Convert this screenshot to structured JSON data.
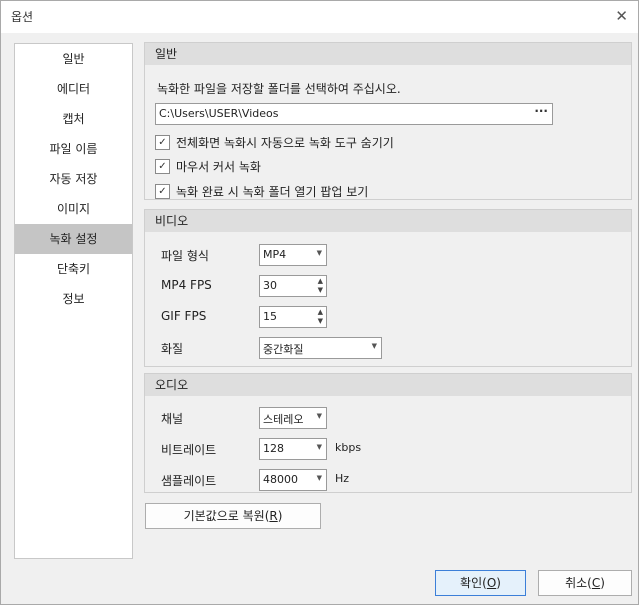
{
  "window": {
    "title": "옵션",
    "close_glyph": "✕"
  },
  "sidebar": {
    "items": [
      {
        "label": "일반"
      },
      {
        "label": "에디터"
      },
      {
        "label": "캡처"
      },
      {
        "label": "파일 이름"
      },
      {
        "label": "자동 저장"
      },
      {
        "label": "이미지"
      },
      {
        "label": "녹화 설정",
        "selected": true
      },
      {
        "label": "단축키"
      },
      {
        "label": "정보"
      }
    ]
  },
  "general": {
    "header": "일반",
    "description": "녹화한 파일을 저장할 폴더를 선택하여 주십시오.",
    "folder_path": "C:\\Users\\USER\\Videos",
    "browse_label": "···",
    "checkboxes": [
      {
        "label": "전체화면 녹화시 자동으로 녹화 도구 숨기기",
        "checked": true
      },
      {
        "label": "마우서 커서 녹화",
        "checked": true
      },
      {
        "label": "녹화 완료 시 녹화 폴더 열기 팝업 보기",
        "checked": true
      }
    ]
  },
  "video": {
    "header": "비디오",
    "format_label": "파일 형식",
    "format_value": "MP4",
    "mp4fps_label": "MP4 FPS",
    "mp4fps_value": "30",
    "giffps_label": "GIF FPS",
    "giffps_value": "15",
    "quality_label": "화질",
    "quality_value": "중간화질"
  },
  "audio": {
    "header": "오디오",
    "channel_label": "채널",
    "channel_value": "스테레오",
    "bitrate_label": "비트레이트",
    "bitrate_value": "128",
    "bitrate_unit": "kbps",
    "samplerate_label": "샘플레이트",
    "samplerate_value": "48000",
    "samplerate_unit": "Hz"
  },
  "buttons": {
    "reset_text": "기본값으로 복원(",
    "reset_key": "R",
    "reset_close": ")",
    "ok_text": "확인(",
    "ok_key": "O",
    "ok_close": ")",
    "cancel_text": "취소(",
    "cancel_key": "C",
    "cancel_close": ")"
  },
  "glyphs": {
    "check": "✓",
    "down_arrow": "▼",
    "up_arrow": "▲"
  },
  "colors": {
    "selected_bg": "#c5c5c5",
    "section_header_bg": "#dedede",
    "primary_border": "#3c7fd8"
  }
}
